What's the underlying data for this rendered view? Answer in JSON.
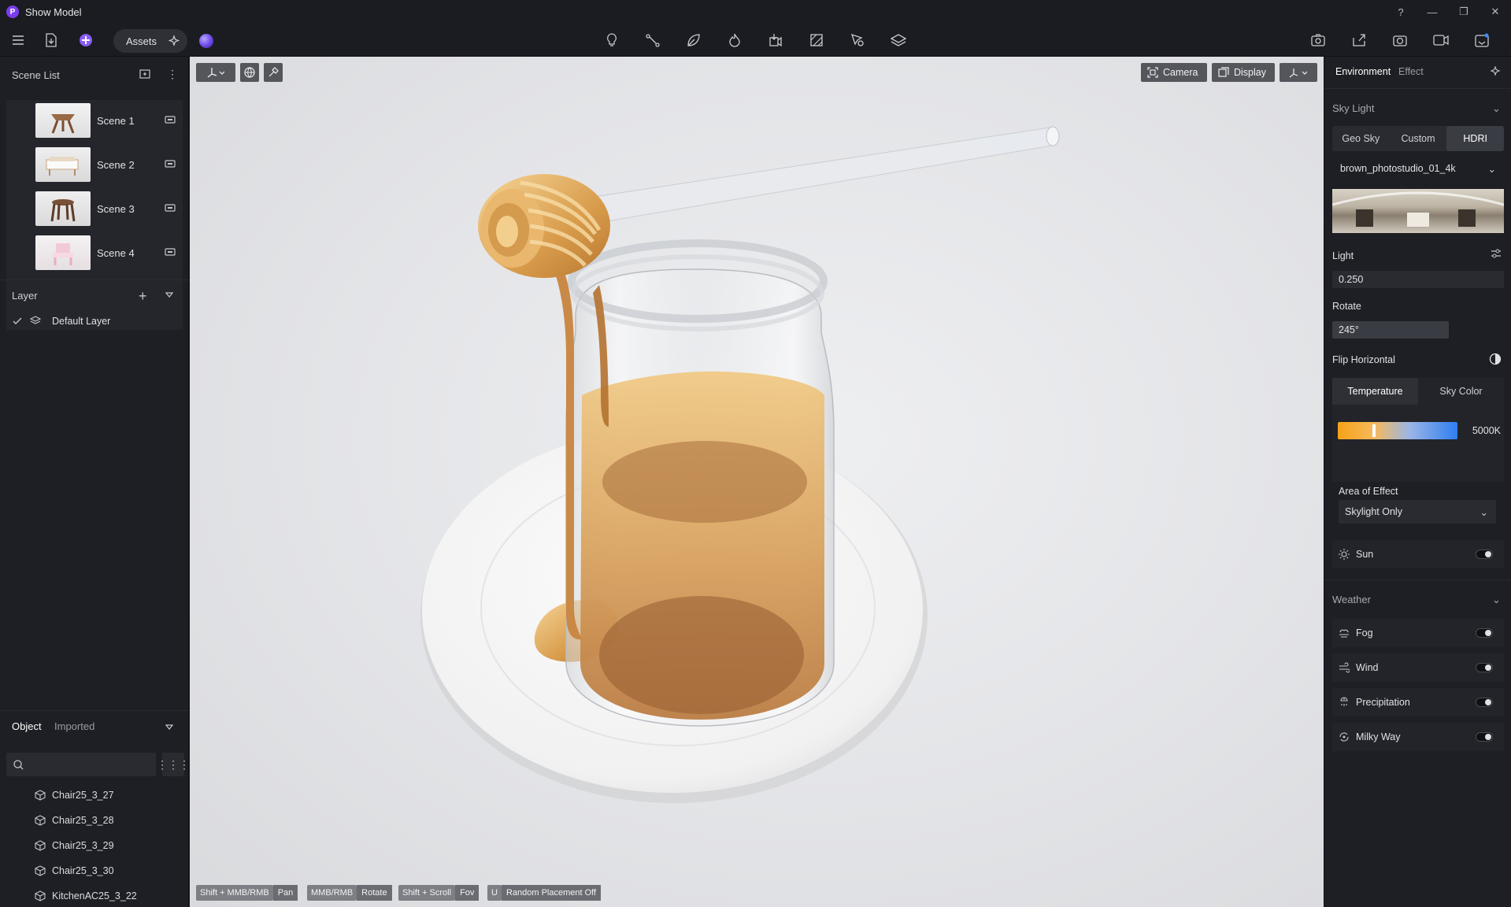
{
  "window": {
    "title": "Show Model",
    "controls": [
      "?",
      "—",
      "❐",
      "✕"
    ]
  },
  "toolbar": {
    "assets_label": "Assets"
  },
  "left": {
    "scene_list_title": "Scene List",
    "scenes": [
      {
        "label": "Scene 1"
      },
      {
        "label": "Scene 2"
      },
      {
        "label": "Scene 3"
      },
      {
        "label": "Scene 4"
      }
    ],
    "layer_title": "Layer",
    "default_layer": "Default Layer",
    "tabs": {
      "object": "Object",
      "imported": "Imported"
    },
    "objects": [
      "Chair25_3_27",
      "Chair25_3_28",
      "Chair25_3_29",
      "Chair25_3_30",
      "KitchenAC25_3_22"
    ]
  },
  "viewport": {
    "camera_label": "Camera",
    "display_label": "Display",
    "hints": [
      {
        "key": "Shift + MMB/RMB",
        "action": "Pan"
      },
      {
        "key": "MMB/RMB",
        "action": "Rotate"
      },
      {
        "key": "Shift + Scroll",
        "action": "Fov"
      },
      {
        "key": "U",
        "action": "Random Placement Off"
      }
    ]
  },
  "right": {
    "tabs": {
      "environment": "Environment",
      "effect": "Effect"
    },
    "sky_light_title": "Sky Light",
    "sky_modes": [
      "Geo Sky",
      "Custom",
      "HDRI"
    ],
    "hdri_name": "brown_photostudio_01_4k",
    "light_label": "Light",
    "light_value": "0.250",
    "rotate_label": "Rotate",
    "rotate_value": "245°",
    "flip_label": "Flip Horizontal",
    "temp_tabs": {
      "temperature": "Temperature",
      "sky_color": "Sky Color"
    },
    "temperature_value": "5000K",
    "area_label": "Area of Effect",
    "area_value": "Skylight Only",
    "sun_label": "Sun",
    "weather_title": "Weather",
    "weather_items": [
      "Fog",
      "Wind",
      "Precipitation",
      "Milky Way"
    ]
  },
  "colors": {
    "accent": "#7b3cf0",
    "panel": "#1e1f24",
    "viewport_bg": "#e3e4e7"
  }
}
